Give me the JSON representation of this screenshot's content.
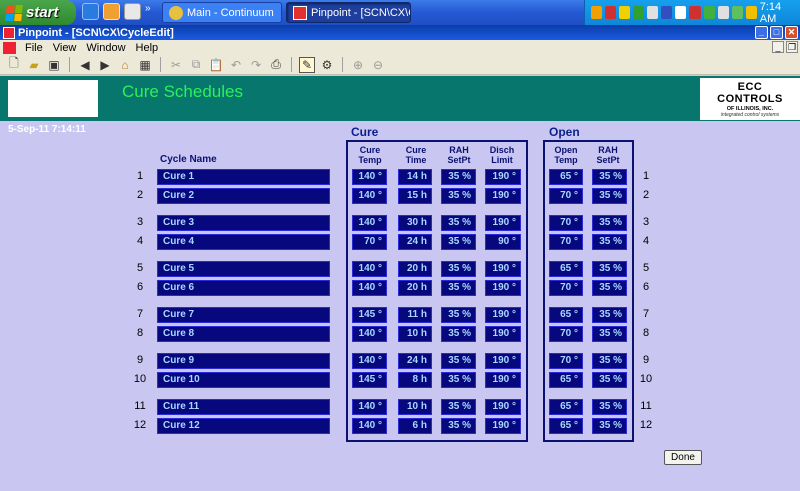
{
  "taskbar": {
    "start_label": "start",
    "tasks": [
      "Main - Continuum",
      "Pinpoint - [SCN\\CX\\C..."
    ],
    "clock": "7:14 AM"
  },
  "window": {
    "title": "Pinpoint - [SCN\\CX\\CycleEdit]"
  },
  "menu": [
    "File",
    "View",
    "Window",
    "Help"
  ],
  "screen": {
    "title": "Cure Schedules",
    "datetime": "5-Sep-11  7:14:11",
    "logo": {
      "main": "ECC CONTROLS",
      "sub1": "OF ILLINOIS, INC.",
      "sub2": "integrated control systems"
    }
  },
  "groups": {
    "cure": "Cure",
    "open": "Open"
  },
  "columns": {
    "cycle_name": "Cycle Name",
    "cure_temp": [
      "Cure",
      "Temp"
    ],
    "cure_time": [
      "Cure",
      "Time"
    ],
    "rah_setpt": [
      "RAH",
      "SetPt"
    ],
    "disch_limit": [
      "Disch",
      "Limit"
    ],
    "open_temp": [
      "Open",
      "Temp"
    ],
    "open_rah_setpt": [
      "RAH",
      "SetPt"
    ]
  },
  "rows": [
    {
      "num": "1",
      "name": "Cure 1",
      "cure_temp": "140 °",
      "cure_time": "14 h",
      "rah": "35 %",
      "disch": "190 °",
      "open_temp": "65 °",
      "open_rah": "35 %"
    },
    {
      "num": "2",
      "name": "Cure 2",
      "cure_temp": "140 °",
      "cure_time": "15 h",
      "rah": "35 %",
      "disch": "190 °",
      "open_temp": "70 °",
      "open_rah": "35 %"
    },
    {
      "num": "3",
      "name": "Cure 3",
      "cure_temp": "140 °",
      "cure_time": "30 h",
      "rah": "35 %",
      "disch": "190 °",
      "open_temp": "70 °",
      "open_rah": "35 %"
    },
    {
      "num": "4",
      "name": "Cure 4",
      "cure_temp": "70 °",
      "cure_time": "24 h",
      "rah": "35 %",
      "disch": "90 °",
      "open_temp": "70 °",
      "open_rah": "35 %"
    },
    {
      "num": "5",
      "name": "Cure 5",
      "cure_temp": "140 °",
      "cure_time": "20 h",
      "rah": "35 %",
      "disch": "190 °",
      "open_temp": "65 °",
      "open_rah": "35 %"
    },
    {
      "num": "6",
      "name": "Cure 6",
      "cure_temp": "140 °",
      "cure_time": "20 h",
      "rah": "35 %",
      "disch": "190 °",
      "open_temp": "70 °",
      "open_rah": "35 %"
    },
    {
      "num": "7",
      "name": "Cure 7",
      "cure_temp": "145 °",
      "cure_time": "11 h",
      "rah": "35 %",
      "disch": "190 °",
      "open_temp": "65 °",
      "open_rah": "35 %"
    },
    {
      "num": "8",
      "name": "Cure 8",
      "cure_temp": "140 °",
      "cure_time": "10 h",
      "rah": "35 %",
      "disch": "190 °",
      "open_temp": "70 °",
      "open_rah": "35 %"
    },
    {
      "num": "9",
      "name": "Cure 9",
      "cure_temp": "140 °",
      "cure_time": "24 h",
      "rah": "35 %",
      "disch": "190 °",
      "open_temp": "70 °",
      "open_rah": "35 %"
    },
    {
      "num": "10",
      "name": "Cure 10",
      "cure_temp": "145 °",
      "cure_time": "8 h",
      "rah": "35 %",
      "disch": "190 °",
      "open_temp": "65 °",
      "open_rah": "35 %"
    },
    {
      "num": "11",
      "name": "Cure 11",
      "cure_temp": "140 °",
      "cure_time": "10 h",
      "rah": "35 %",
      "disch": "190 °",
      "open_temp": "65 °",
      "open_rah": "35 %"
    },
    {
      "num": "12",
      "name": "Cure 12",
      "cure_temp": "140 °",
      "cure_time": "6 h",
      "rah": "35 %",
      "disch": "190 °",
      "open_temp": "65 °",
      "open_rah": "35 %"
    }
  ],
  "buttons": {
    "done": "Done"
  }
}
